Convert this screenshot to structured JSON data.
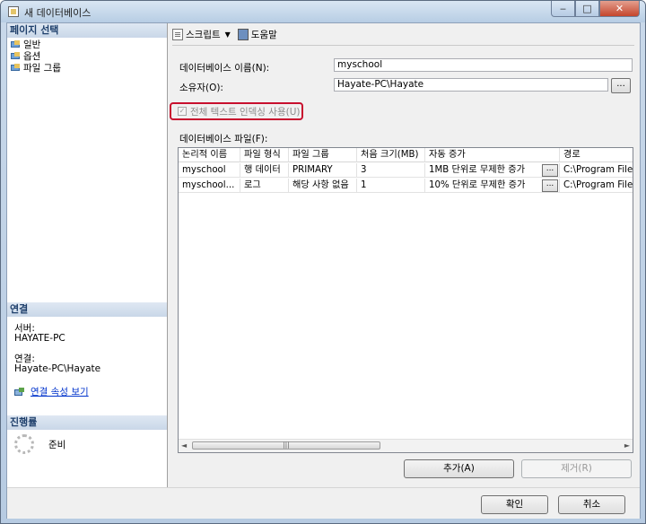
{
  "window": {
    "title": "새 데이터베이스",
    "min_label": "‒",
    "max_label": "□",
    "close_label": "✕"
  },
  "left": {
    "page_select_title": "페이지 선택",
    "pages": [
      {
        "label": "일반"
      },
      {
        "label": "옵션"
      },
      {
        "label": "파일 그룹"
      }
    ],
    "connection_title": "연결",
    "server_label": "서버:",
    "server_value": "HAYATE-PC",
    "connection_label": "연결:",
    "connection_value": "Hayate-PC\\Hayate",
    "view_props_link": "연결 속성 보기",
    "progress_title": "진행률",
    "progress_status": "준비"
  },
  "toolbar": {
    "script_label": "스크립트",
    "help_label": "도움말"
  },
  "form": {
    "db_name_label": "데이터베이스 이름(N):",
    "db_name_value": "myschool",
    "owner_label": "소유자(O):",
    "owner_value": "Hayate-PC\\Hayate",
    "browse_label": "...",
    "fulltext_label": "전체 텍스트 인덱싱 사용(U)",
    "fulltext_checked": true,
    "files_label": "데이터베이스 파일(F):"
  },
  "grid": {
    "columns": [
      "논리적 이름",
      "파일 형식",
      "파일 그룹",
      "처음 크기(MB)",
      "자동 증가",
      "경로"
    ],
    "rows": [
      [
        "myschool",
        "행 데이터",
        "PRIMARY",
        "3",
        "1MB 단위로 무제한 증가",
        "C:\\Program File"
      ],
      [
        "myschool...",
        "로그",
        "해당 사항 없음",
        "1",
        "10% 단위로 무제한 증가",
        "C:\\Program File"
      ]
    ],
    "cell_button_label": "...",
    "scroll_left": "◄",
    "scroll_right": "►",
    "scroll_grip": "|||"
  },
  "buttons": {
    "add": "추가(A)",
    "remove": "제거(R)",
    "ok": "확인",
    "cancel": "취소"
  }
}
